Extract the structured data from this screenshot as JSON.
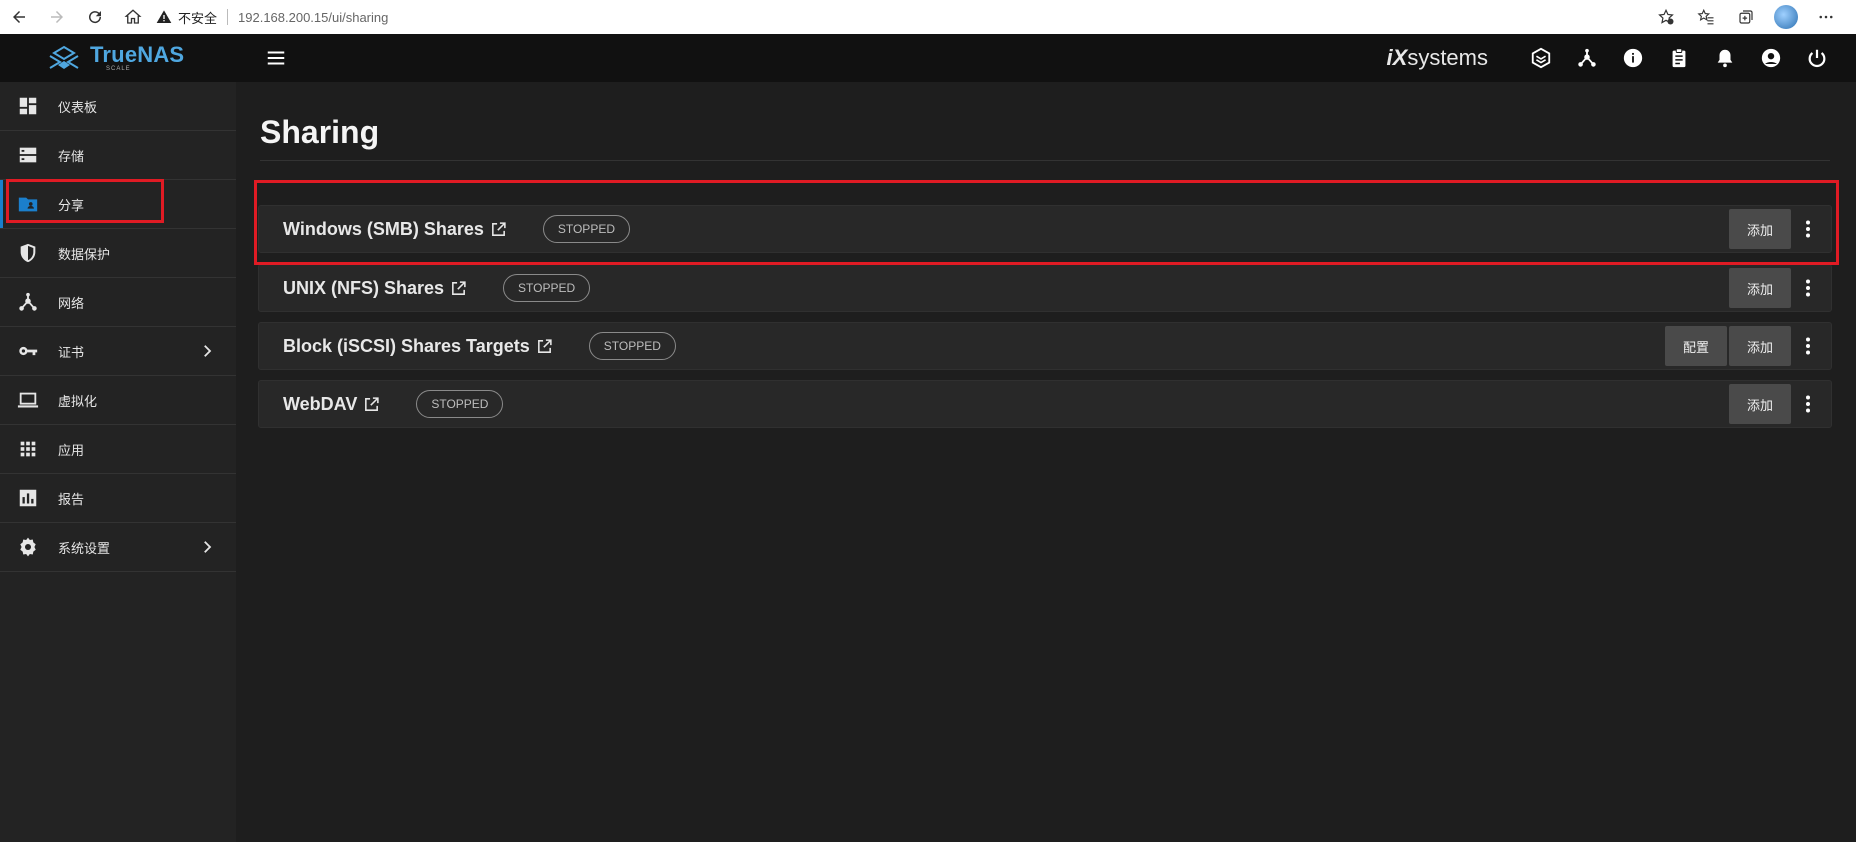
{
  "browser": {
    "insecure_label": "不安全",
    "url": "192.168.200.15/ui/sharing"
  },
  "app": {
    "logo_name": "TrueNAS",
    "logo_sub": "SCALE",
    "brand_prefix": "iX",
    "brand_suffix": "systems"
  },
  "sidebar": {
    "items": [
      {
        "label": "仪表板",
        "icon": "dashboard-icon"
      },
      {
        "label": "存储",
        "icon": "storage-icon"
      },
      {
        "label": "分享",
        "icon": "folder-shared-icon",
        "active": true
      },
      {
        "label": "数据保护",
        "icon": "shield-icon"
      },
      {
        "label": "网络",
        "icon": "network-icon"
      },
      {
        "label": "证书",
        "icon": "key-icon",
        "expandable": true
      },
      {
        "label": "虚拟化",
        "icon": "laptop-icon"
      },
      {
        "label": "应用",
        "icon": "apps-grid-icon"
      },
      {
        "label": "报告",
        "icon": "chart-icon"
      },
      {
        "label": "系统设置",
        "icon": "gear-icon",
        "expandable": true
      }
    ]
  },
  "main": {
    "title": "Sharing",
    "cards": [
      {
        "title": "Windows (SMB) Shares",
        "status": "STOPPED",
        "config_label": "",
        "add_label": "添加"
      },
      {
        "title": "UNIX (NFS) Shares",
        "status": "STOPPED",
        "config_label": "",
        "add_label": "添加"
      },
      {
        "title": "Block (iSCSI) Shares Targets",
        "status": "STOPPED",
        "config_label": "配置",
        "add_label": "添加"
      },
      {
        "title": "WebDAV",
        "status": "STOPPED",
        "config_label": "",
        "add_label": "添加"
      }
    ]
  },
  "colors": {
    "accent": "#4fa7e0",
    "highlight": "#e01b24",
    "background": "#1e1e1e",
    "card": "#282828"
  }
}
